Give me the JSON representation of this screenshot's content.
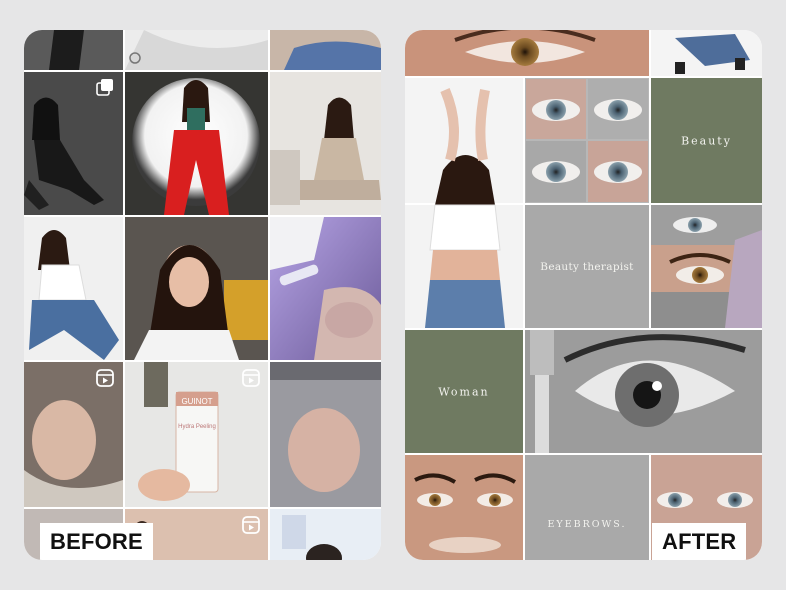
{
  "before_label": "BEFORE",
  "after_label": "AFTER",
  "after_tiles": {
    "beauty": "Beauty",
    "beauty_therapist": "Beauty therapist",
    "woman": "Woman",
    "eyebrows": "EYEBROWS."
  },
  "product_brand": "GUINOT",
  "product_name": "Hydra Peeling",
  "colors": {
    "olive": "#6f7a61",
    "gray_tile": "#a9a9a9",
    "background": "#e6e6e7"
  }
}
